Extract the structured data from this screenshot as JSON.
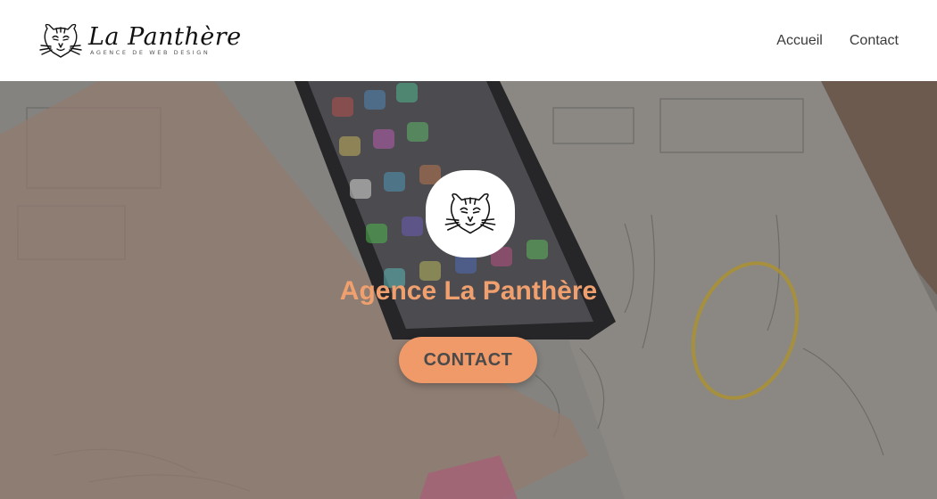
{
  "header": {
    "brand": {
      "name": "La Panthère",
      "tagline": "AGENCE DE WEB DESIGN",
      "logo_icon": "panther-head-icon"
    },
    "nav": [
      {
        "label": "Accueil"
      },
      {
        "label": "Contact"
      }
    ]
  },
  "hero": {
    "emblem_icon": "panther-head-icon",
    "title": "Agence La Panthère",
    "cta_label": "CONTACT"
  },
  "colors": {
    "accent": "#f09a6a",
    "title": "#f0a06e",
    "nav_text": "#3a3a3a",
    "header_bg": "#ffffff"
  }
}
